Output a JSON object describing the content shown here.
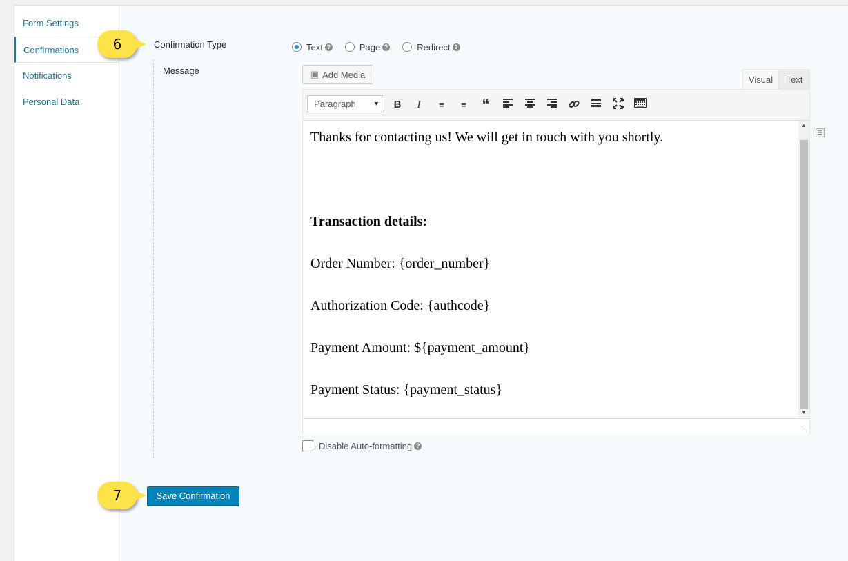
{
  "tabs": [
    {
      "label": "Form Settings",
      "active": false
    },
    {
      "label": "Confirmations",
      "active": true
    },
    {
      "label": "Notifications",
      "active": false
    },
    {
      "label": "Personal Data",
      "active": false
    }
  ],
  "confirmation_type": {
    "label": "Confirmation Type",
    "options": [
      {
        "label": "Text",
        "checked": true
      },
      {
        "label": "Page",
        "checked": false
      },
      {
        "label": "Redirect",
        "checked": false
      }
    ]
  },
  "message": {
    "label": "Message",
    "add_media_label": "Add Media",
    "mode_tabs": {
      "visual": "Visual",
      "text": "Text"
    },
    "format_select": "Paragraph",
    "toolbar_icons": [
      "bold-icon",
      "italic-icon",
      "bullet-list-icon",
      "numbered-list-icon",
      "blockquote-icon",
      "align-left-icon",
      "align-center-icon",
      "align-right-icon",
      "link-icon",
      "read-more-icon",
      "fullscreen-icon",
      "toolbar-toggle-icon"
    ],
    "lines": [
      "Thanks for contacting us! We will get in touch with you shortly.",
      "Transaction details:",
      "Order Number: {order_number}",
      "Authorization Code: {authcode}",
      "Payment Amount: ${payment_amount}",
      "Payment Status: {payment_status}"
    ]
  },
  "disable_autoformat_label": "Disable Auto-formatting",
  "save_button_label": "Save Confirmation",
  "callouts": {
    "step6": "6",
    "step7": "7"
  },
  "colors": {
    "accent": "#0085ba",
    "link": "#21759b",
    "callout": "#fde248"
  }
}
